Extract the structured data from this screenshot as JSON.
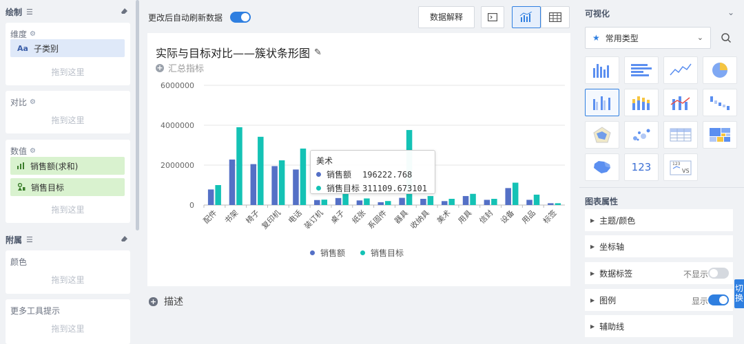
{
  "left": {
    "draw_section": {
      "title": "绘制"
    },
    "dimension": {
      "label": "维度",
      "chip": "子类别",
      "chip_icon": "Aa",
      "drop": "拖到这里"
    },
    "compare": {
      "label": "对比",
      "drop": "拖到这里"
    },
    "values": {
      "label": "数值",
      "chips": [
        "销售额(求和)",
        "销售目标"
      ],
      "drop": "拖到这里"
    },
    "attach_section": {
      "title": "附属"
    },
    "color": {
      "label": "颜色",
      "drop": "拖到这里"
    },
    "tooltip_more": {
      "label": "更多工具提示",
      "drop": "拖到这里"
    }
  },
  "toolbar": {
    "auto_refresh_label": "更改后自动刷新数据",
    "auto_refresh_on": true,
    "explain_label": "数据解释"
  },
  "chart_card": {
    "title": "实际与目标对比——簇状条形图",
    "summary_label": "汇总指标",
    "description_label": "描述"
  },
  "tooltip": {
    "category": "美术",
    "rows": [
      {
        "name": "销售额",
        "value": "196222.768"
      },
      {
        "name": "销售目标",
        "value": "311109.673101"
      }
    ]
  },
  "colors": {
    "sales": "#5470c6",
    "target": "#14c2b5",
    "accent": "#2f7fe0"
  },
  "chart_data": {
    "type": "bar",
    "title": "",
    "xlabel": "",
    "ylabel": "",
    "ylim": [
      0,
      6000000
    ],
    "yticks": [
      "6000000",
      "4000000",
      "2000000",
      "0"
    ],
    "grid": true,
    "legend": "bottom",
    "categories": [
      "配件",
      "书架",
      "椅子",
      "复印机",
      "电话",
      "装订机",
      "桌子",
      "纸张",
      "系固件",
      "器具",
      "收纳具",
      "美术",
      "用具",
      "信封",
      "设备",
      "用品",
      "标签"
    ],
    "series": [
      {
        "name": "销售额",
        "values": [
          780000,
          2280000,
          2050000,
          1950000,
          1780000,
          250000,
          350000,
          230000,
          140000,
          360000,
          310000,
          196222.768,
          450000,
          260000,
          850000,
          260000,
          90000
        ]
      },
      {
        "name": "销售目标",
        "values": [
          1000000,
          3900000,
          3420000,
          2240000,
          2830000,
          270000,
          580000,
          330000,
          200000,
          3760000,
          450000,
          311109.673101,
          560000,
          310000,
          1120000,
          520000,
          90000
        ]
      }
    ]
  },
  "right": {
    "title": "可视化",
    "type_select": "常用类型",
    "tile_icons": [
      "bar-chart-icon",
      "horizontal-bar-icon",
      "line-chart-icon",
      "pie-chart-icon",
      "clustered-bar-icon",
      "stacked-bar-icon",
      "combo-bar-line-icon",
      "waterfall-icon",
      "radar-icon",
      "scatter-icon",
      "table-icon",
      "treemap-icon",
      "map-icon",
      "kpi-number-icon",
      "comparison-icon"
    ],
    "kpi_tile_text": "123",
    "compare_tile_top": "123",
    "compare_tile_bottom": "VS",
    "props_title": "图表属性",
    "props": [
      {
        "label": "主题/颜色"
      },
      {
        "label": "坐标轴"
      },
      {
        "label": "数据标签",
        "state_text": "不显示",
        "toggle_on": false
      },
      {
        "label": "图例",
        "state_text": "显示",
        "toggle_on": true
      },
      {
        "label": "辅助线"
      }
    ],
    "side_tab": "切换"
  }
}
